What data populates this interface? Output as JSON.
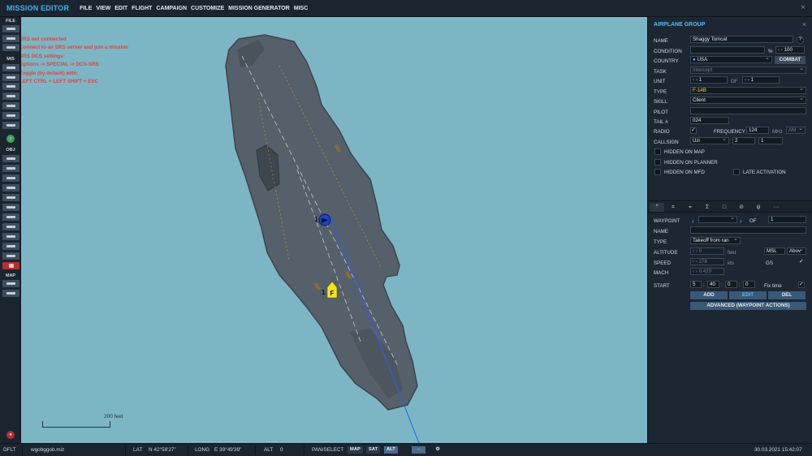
{
  "app": {
    "title": "MISSION EDITOR",
    "menu": [
      "FILE",
      "VIEW",
      "EDIT",
      "FLIGHT",
      "CAMPAIGN",
      "CUSTOMIZE",
      "MISSION GENERATOR",
      "MISC"
    ]
  },
  "toolbar": {
    "sections": [
      "FILE",
      "MIS",
      "OBJ",
      "MAP"
    ]
  },
  "map": {
    "srs_messages": [
      "SRS not connected",
      "Connect to an SRS server and join a mission",
      "SRS DCS settings:",
      "Options -> SPECIAL -> DCS-SRS",
      "Toggle (by default) with:",
      "LEFT CTRL + LEFT SHIFT + ESC"
    ],
    "scale_label": "200 feet",
    "waypoint_index": "1",
    "group_index": "1",
    "group_marker_letter": "F",
    "water_color": "#7cb6c4",
    "route_color": "#2060ff"
  },
  "panel": {
    "title": "AIRPLANE GROUP",
    "name_label": "NAME",
    "name_value": "Shaggy Tomcat",
    "help": "?",
    "condition_label": "CONDITION",
    "condition_pct": "%",
    "condition_value": "100",
    "country_label": "COUNTRY",
    "country_value": "USA",
    "combat_button": "COMBAT",
    "task_label": "TASK",
    "task_value": "Intercept",
    "unit_label": "UNIT",
    "unit_value": "1",
    "unit_of": "OF",
    "unit_of_value": "1",
    "type_label": "TYPE",
    "type_value": "F-14B",
    "skill_label": "SKILL",
    "skill_value": "Client",
    "pilot_label": "PILOT",
    "pilot_value": "",
    "tail_label": "TAIL #",
    "tail_value": "024",
    "radio_label": "RADIO",
    "frequency_label": "FREQUENCY",
    "frequency_value": "124",
    "frequency_unit": "MHz",
    "modulation": "AM",
    "callsign_label": "CALLSIGN",
    "callsign_name": "Uzi",
    "callsign_num1": "2",
    "callsign_num2": "1",
    "hidden_map": "HIDDEN ON MAP",
    "hidden_planner": "HIDDEN ON PLANNER",
    "hidden_mfd": "HIDDEN ON MFD",
    "late_activation": "LATE ACTIVATION",
    "accent_color": "#4fc0f2"
  },
  "waypoint": {
    "waypoint_label": "WAYPOINT",
    "waypoint_value": "",
    "of_label": "OF",
    "of_value": "1",
    "name_label": "NAME",
    "name_value": "",
    "type_label": "TYPE",
    "type_value": "Takeoff from ran",
    "altitude_label": "ALTITUDE",
    "altitude_value": "0",
    "altitude_unit": "feet",
    "altitude_ref": "MSL",
    "altitude_mode": "Abov",
    "speed_label": "SPEED",
    "speed_value": "278",
    "speed_unit": "kts",
    "gs_label": "GS",
    "mach_label": "MACH",
    "mach_value": "0.420",
    "start_label": "START",
    "start_day": "5",
    "start_h": "40",
    "start_m": "0",
    "start_s": "0",
    "fix_time": "Fix time",
    "add_button": "ADD",
    "edit_button": "EDIT",
    "del_button": "DEL",
    "advanced_button": "ADVANCED (WAYPOINT ACTIONS)",
    "tab_icons": [
      "route-icon",
      "target-icon",
      "crosshair-icon",
      "sigma-icon",
      "square-icon",
      "no-entry-icon",
      "antenna-icon",
      "more-icon"
    ]
  },
  "status": {
    "mode": "DFLT",
    "file": "wgobggob.miz",
    "lat_label": "LAT",
    "lat_value": "N 42°58'27\"",
    "long_label": "LONG",
    "long_value": "E 39°49'39\"",
    "alt_label": "ALT",
    "alt_value": "0",
    "pan_select": "PAN/SELECT",
    "map_btn": "MAP",
    "sat_btn": "SAT",
    "alt_btn": "ALT",
    "datetime": "30.03.2021 15:42:07"
  }
}
